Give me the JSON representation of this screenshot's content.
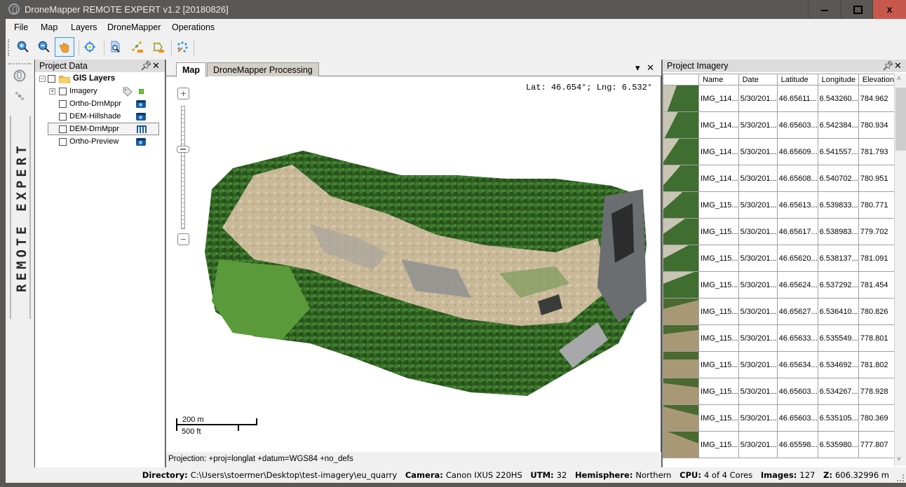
{
  "window": {
    "title": "DroneMapper REMOTE EXPERT v1.2 [20180826]",
    "minimize_label": "",
    "maximize_label": "",
    "close_label": "x"
  },
  "menubar": {
    "items": [
      "File",
      "Map",
      "Layers",
      "DroneMapper",
      "Operations"
    ]
  },
  "toolbar": {
    "buttons": [
      {
        "name": "zoom-in",
        "icon": "zoom-in-icon"
      },
      {
        "name": "zoom-out",
        "icon": "zoom-out-icon"
      },
      {
        "name": "pan",
        "icon": "hand-pan-icon",
        "active": true
      },
      {
        "name": "locate",
        "icon": "crosshair-icon"
      },
      {
        "name": "identify",
        "icon": "identify-icon"
      },
      {
        "name": "measure-distance",
        "icon": "measure-line-icon"
      },
      {
        "name": "measure-area",
        "icon": "measure-area-icon"
      },
      {
        "name": "point-picker",
        "icon": "point-picker-icon"
      }
    ]
  },
  "left_strip": {
    "brand_text": "REMOTE EXPERT",
    "icons": [
      "dronemapper-logo-icon",
      "satellite-icon"
    ]
  },
  "project_data": {
    "title": "Project Data",
    "pin": "q",
    "close": "✕",
    "root": {
      "label": "GIS Layers",
      "expander": "−"
    },
    "layers": [
      {
        "label": "Imagery",
        "expander": "+",
        "icon": "tag-icon",
        "status_color": "#66cc33"
      },
      {
        "label": "Ortho-DrnMppr",
        "icon": "raster-camera-icon"
      },
      {
        "label": "DEM-Hillshade",
        "icon": "raster-camera-icon"
      },
      {
        "label": "DEM-DrnMppr",
        "icon": "raster-grid-icon",
        "selected": true
      },
      {
        "label": "Ortho-Preview",
        "icon": "raster-camera-icon"
      }
    ]
  },
  "map": {
    "tabs": [
      {
        "label": "Map",
        "active": true
      },
      {
        "label": "DroneMapper Processing",
        "active": false
      }
    ],
    "tab_menu": "▾",
    "tab_close": "✕",
    "coordinate_readout": "Lat: 46.654°; Lng: 6.532°",
    "zoom_in": "+",
    "zoom_out": "−",
    "scale_metric": "200 m",
    "scale_imperial": "500 ft",
    "projection": "Projection: +proj=longlat +datum=WGS84 +no_defs"
  },
  "imagery": {
    "title": "Project Imagery",
    "pin": "q",
    "close": "✕",
    "columns": [
      "",
      "Name",
      "Date",
      "Latitude",
      "Longitude",
      "Elevation"
    ],
    "rows": [
      {
        "name": "IMG_114...",
        "date": "5/30/201...",
        "lat": "46.65611...",
        "lng": "6.543260...",
        "elev": "784.962"
      },
      {
        "name": "IMG_114...",
        "date": "5/30/201...",
        "lat": "46.65603...",
        "lng": "6.542384...",
        "elev": "780.934"
      },
      {
        "name": "IMG_114...",
        "date": "5/30/201...",
        "lat": "46.65609...",
        "lng": "6.541557...",
        "elev": "781.793"
      },
      {
        "name": "IMG_114...",
        "date": "5/30/201...",
        "lat": "46.65608...",
        "lng": "6.540702...",
        "elev": "780.951"
      },
      {
        "name": "IMG_115...",
        "date": "5/30/201...",
        "lat": "46.65613...",
        "lng": "6.539833...",
        "elev": "780.771"
      },
      {
        "name": "IMG_115...",
        "date": "5/30/201...",
        "lat": "46.65617...",
        "lng": "6.538983...",
        "elev": "779.702"
      },
      {
        "name": "IMG_115...",
        "date": "5/30/201...",
        "lat": "46.65620...",
        "lng": "6.538137...",
        "elev": "781.091"
      },
      {
        "name": "IMG_115...",
        "date": "5/30/201...",
        "lat": "46.65624...",
        "lng": "6.537292...",
        "elev": "781.454"
      },
      {
        "name": "IMG_115...",
        "date": "5/30/201...",
        "lat": "46.65627...",
        "lng": "6.536410...",
        "elev": "780.826"
      },
      {
        "name": "IMG_115...",
        "date": "5/30/201...",
        "lat": "46.65633...",
        "lng": "6.535549...",
        "elev": "778.801"
      },
      {
        "name": "IMG_115...",
        "date": "5/30/201...",
        "lat": "46.65634...",
        "lng": "6.534692...",
        "elev": "781.802"
      },
      {
        "name": "IMG_115...",
        "date": "5/30/201...",
        "lat": "46.65603...",
        "lng": "6.534267...",
        "elev": "778.928"
      },
      {
        "name": "IMG_115...",
        "date": "5/30/201...",
        "lat": "46.65603...",
        "lng": "6.535105...",
        "elev": "780.369"
      },
      {
        "name": "IMG_115...",
        "date": "5/30/201...",
        "lat": "46.65598...",
        "lng": "6.535980...",
        "elev": "777.807"
      }
    ],
    "scroll_up": "˄",
    "scroll_down": "˅"
  },
  "statusbar": {
    "directory_label": "Directory:",
    "directory": "C:\\Users\\stoermer\\Desktop\\test-imagery\\eu_quarry",
    "camera_label": "Camera:",
    "camera": "Canon IXUS 220HS",
    "utm_label": "UTM:",
    "utm": "32",
    "hemisphere_label": "Hemisphere:",
    "hemisphere": "Northern",
    "cpu_label": "CPU:",
    "cpu": "4 of 4 Cores",
    "images_label": "Images:",
    "images": "127",
    "z_label": "Z:",
    "z": "606.32996 m"
  },
  "colors": {
    "titlebar": "#5a5856",
    "close_button": "#c9584c",
    "active_tool_border": "#3d8ee0",
    "layer_icon_blue": "#1b5a9c",
    "imagery_status": "#66cc33"
  }
}
